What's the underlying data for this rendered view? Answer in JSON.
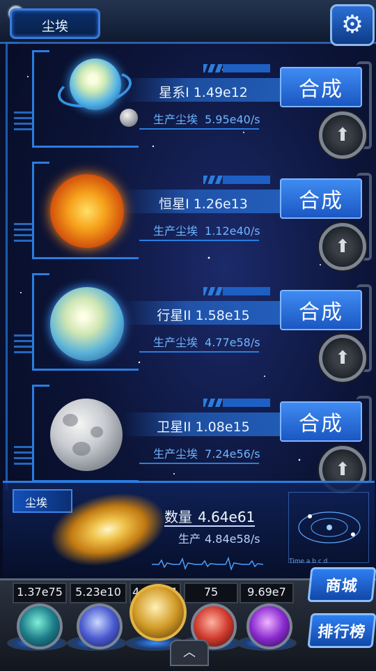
{
  "header": {
    "title": "尘埃",
    "settings_icon": "gear-icon"
  },
  "rows": [
    {
      "planet": "galaxy",
      "name": "星系I 1.49e12",
      "prod_label": "生产尘埃",
      "prod_value": "5.95e40/s",
      "combine_label": "合成",
      "upgrade_icon": "arrow-up-icon"
    },
    {
      "planet": "star",
      "name": "恒星I 1.26e13",
      "prod_label": "生产尘埃",
      "prod_value": "1.12e40/s",
      "combine_label": "合成",
      "upgrade_icon": "arrow-up-icon"
    },
    {
      "planet": "planet",
      "name": "行星II 1.58e15",
      "prod_label": "生产尘埃",
      "prod_value": "4.77e58/s",
      "combine_label": "合成",
      "upgrade_icon": "arrow-up-icon"
    },
    {
      "planet": "moon",
      "name": "卫星II 1.08e15",
      "prod_label": "生产尘埃",
      "prod_value": "7.24e56/s",
      "combine_label": "合成",
      "upgrade_icon": "arrow-up-icon"
    }
  ],
  "dust": {
    "label": "尘埃",
    "qty_label": "数量",
    "qty_value": "4.64e61",
    "prod_label": "生产",
    "prod_value": "4.84e58/s",
    "orbit_axis": "Time  a  b  c  d"
  },
  "tray": {
    "counts": [
      "1.37e75",
      "5.23e10",
      "4.64e61",
      "75",
      "9.69e7"
    ],
    "orbs": [
      "molecule-orb",
      "lightning-orb",
      "dust-orb",
      "brain-orb",
      "vortex-orb"
    ],
    "shop_label": "商城",
    "rank_label": "排行榜",
    "expand_icon": "chevron-up-icon"
  },
  "colors": {
    "accent": "#2a7de0",
    "button": "#2f7ff0",
    "text_highlight": "#6fb6ff"
  }
}
